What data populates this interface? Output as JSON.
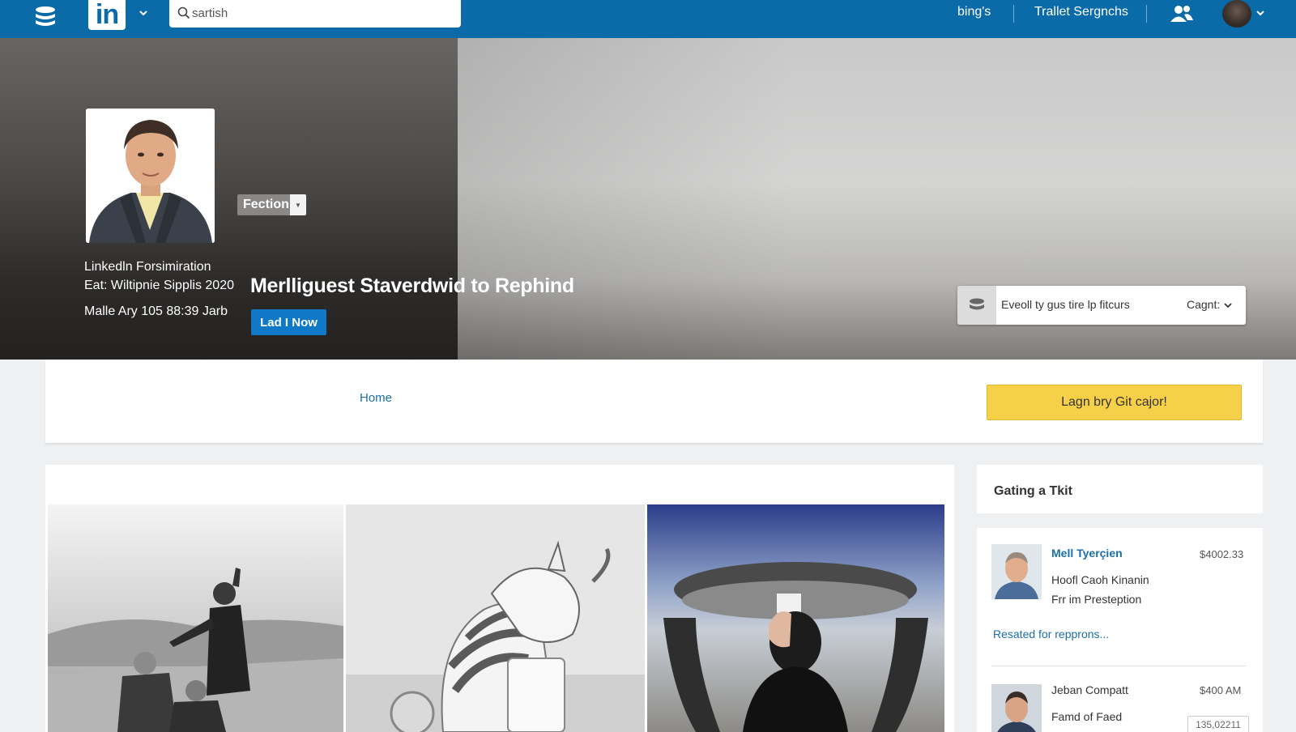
{
  "topbar": {
    "logo_text": "in",
    "search_placeholder": "sartish",
    "nav_links": [
      "bing's",
      "Trallet Sergnchs"
    ],
    "icons": [
      "stack-menu-icon",
      "chevron-down-icon",
      "search-icon",
      "people-icon",
      "user-avatar",
      "chevron-down-icon"
    ]
  },
  "hero": {
    "profile_button": "Fection",
    "info_lines": [
      "Linkedln Forsimiration",
      "Eat: Wiltipnie Sipplis 2020",
      "Malle Ary 105 88:39 Jarb"
    ],
    "title": "Merlliguest Staverdwid to Rephind",
    "cta_label": "Lad I Now",
    "filter_text": "Eveoll ty gus tire lp fitcurs",
    "filter_select": "Cagnt:"
  },
  "strip": {
    "home_label": "Home",
    "yellow_button": "Lagn bry Git cajor!"
  },
  "rail": {
    "heading": "Gating a Tkit",
    "items": [
      {
        "name": "Mell Tyerçien",
        "price": "$4002.33",
        "line1": "Hoofl Caoh Kinanin",
        "line2": "Frr im Prestеption"
      },
      {
        "name": "Jeban Compatt",
        "price": "$400 AM",
        "line1": "Famd of Faed",
        "badge": "135,02211"
      }
    ],
    "link_text": "Resated for repprons..."
  },
  "colors": {
    "brand": "#0b6aa8",
    "link": "#1b6fa8",
    "cta": "#0f79c8",
    "yellow": "#f7d04a"
  }
}
